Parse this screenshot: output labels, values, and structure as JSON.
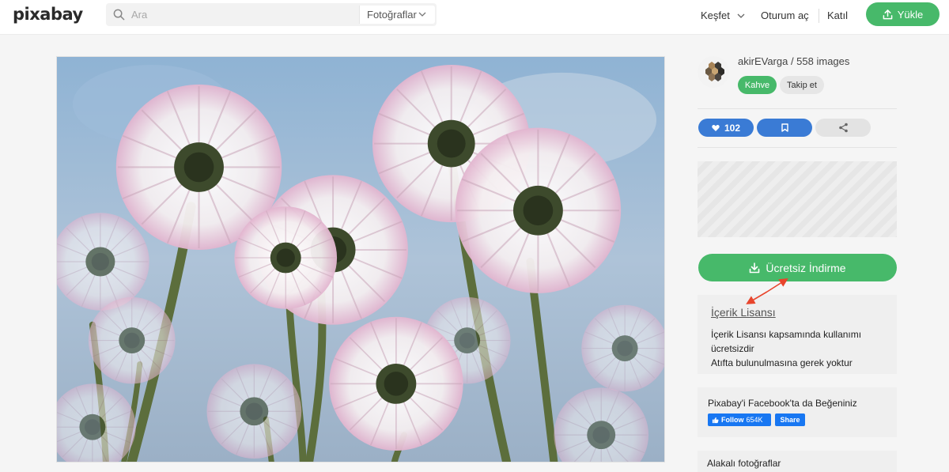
{
  "header": {
    "logo": "pixabay",
    "search_placeholder": "Ara",
    "search_type": "Fotoğraflar",
    "nav_explore": "Keşfet",
    "nav_login": "Oturum aç",
    "nav_join": "Katıl",
    "upload_label": "Yükle"
  },
  "sidebar": {
    "author": "akirEVarga / 558 images",
    "coffee_label": "Kahve",
    "follow_label": "Takip et",
    "likes": "102",
    "download_label": "Ücretsiz İndirme",
    "license_link": "İçerik Lisansı",
    "license_line1": "İçerik Lisansı kapsamında kullanımı ücretsizdir",
    "license_line2": "Atıfta bulunulmasına gerek yoktur",
    "fb_title": "Pixabay'i Facebook'ta da Beğeniniz",
    "fb_follow": "Follow",
    "fb_count": "654K",
    "fb_share": "Share",
    "related_title": "Alakalı fotoğraflar"
  },
  "colors": {
    "green": "#47b96a",
    "blue": "#3a7bd5",
    "facebook": "#1877f2",
    "annotation_arrow": "#e8452c"
  },
  "icons": [
    "search-icon",
    "chevron-down-icon",
    "upload-icon",
    "heart-icon",
    "bookmark-icon",
    "share-icon",
    "download-icon",
    "facebook-like-icon"
  ]
}
